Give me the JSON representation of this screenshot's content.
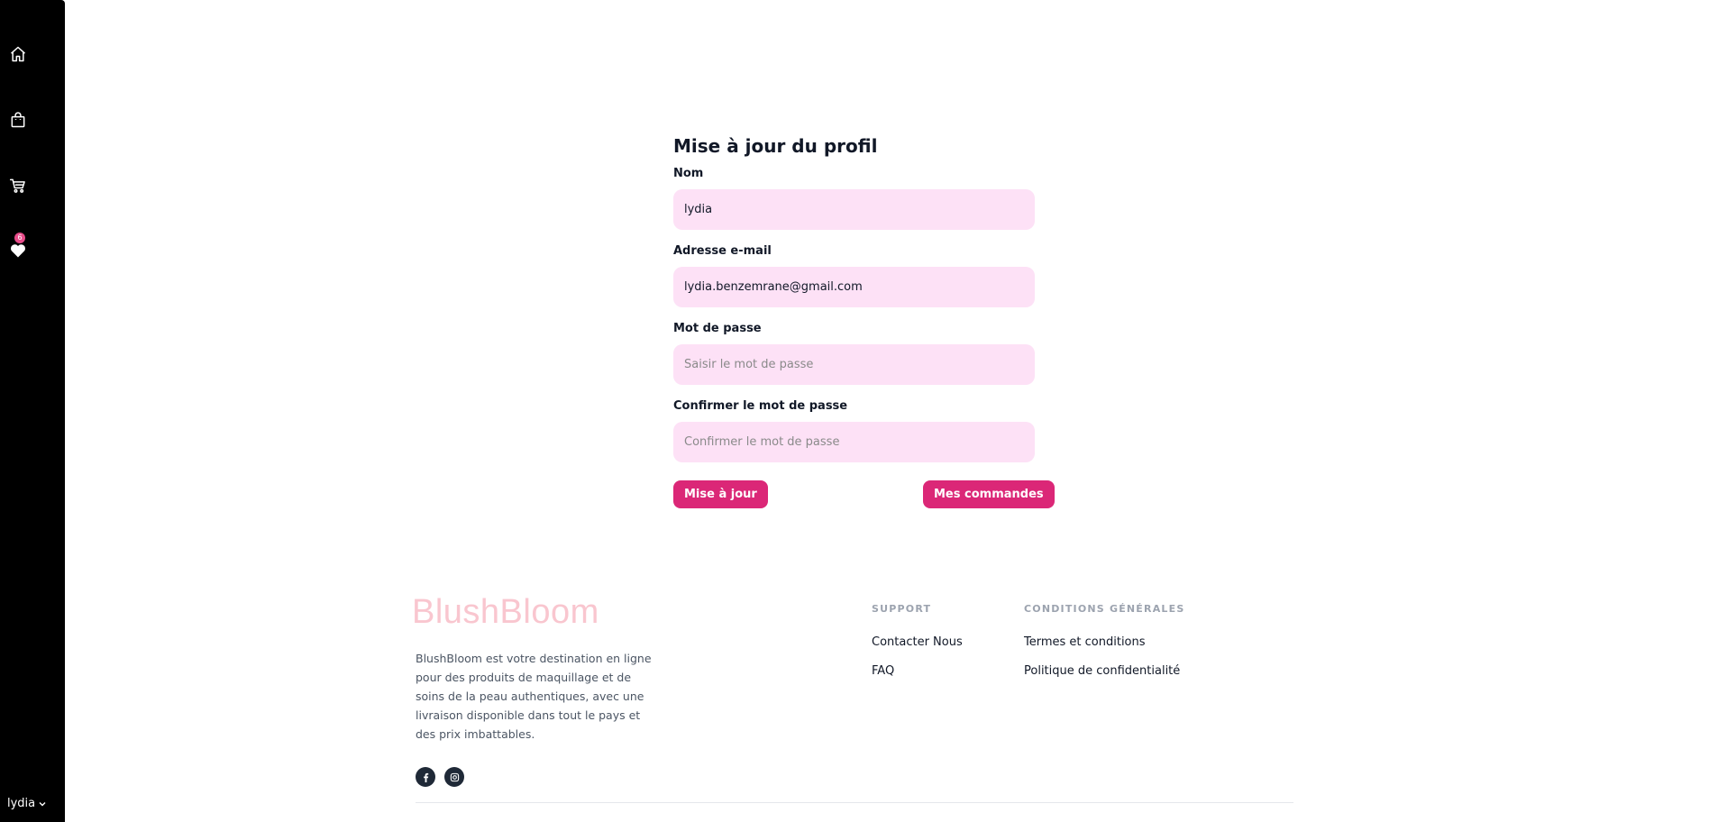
{
  "sidebar": {
    "icons": [
      "home-icon",
      "bag-icon",
      "cart-icon",
      "heart-icon"
    ],
    "wishlist_count": "6",
    "user_name": "lydia"
  },
  "form": {
    "title": "Mise à jour du profil",
    "name": {
      "label": "Nom",
      "value": "lydia"
    },
    "email": {
      "label": "Adresse e-mail",
      "value": "lydia.benzemrane@gmail.com"
    },
    "password": {
      "label": "Mot de passe",
      "placeholder": "Saisir le mot de passe"
    },
    "confirm": {
      "label": "Confirmer le mot de passe",
      "placeholder": "Confirmer le mot de passe"
    },
    "update_button": "Mise à jour",
    "orders_button": "Mes commandes"
  },
  "footer": {
    "brand": "BlushBloom",
    "description": "BlushBloom est votre destination en ligne pour des produits de maquillage et de soins de la peau authentiques, avec une livraison disponible dans tout le pays et des prix imbattables.",
    "social": [
      "facebook-icon",
      "instagram-icon"
    ],
    "support": {
      "heading": "SUPPORT",
      "links": [
        "Contacter Nous",
        "FAQ"
      ]
    },
    "conditions": {
      "heading": "CONDITIONS GÉNÉRALES",
      "links": [
        "Termes et conditions",
        "Politique de confidentialité"
      ]
    }
  },
  "colors": {
    "sidebar_bg": "#000000",
    "input_bg": "#fde1f6",
    "button_bg": "#db2777",
    "brand": "#f9c6cf",
    "badge": "#e84c8a"
  }
}
